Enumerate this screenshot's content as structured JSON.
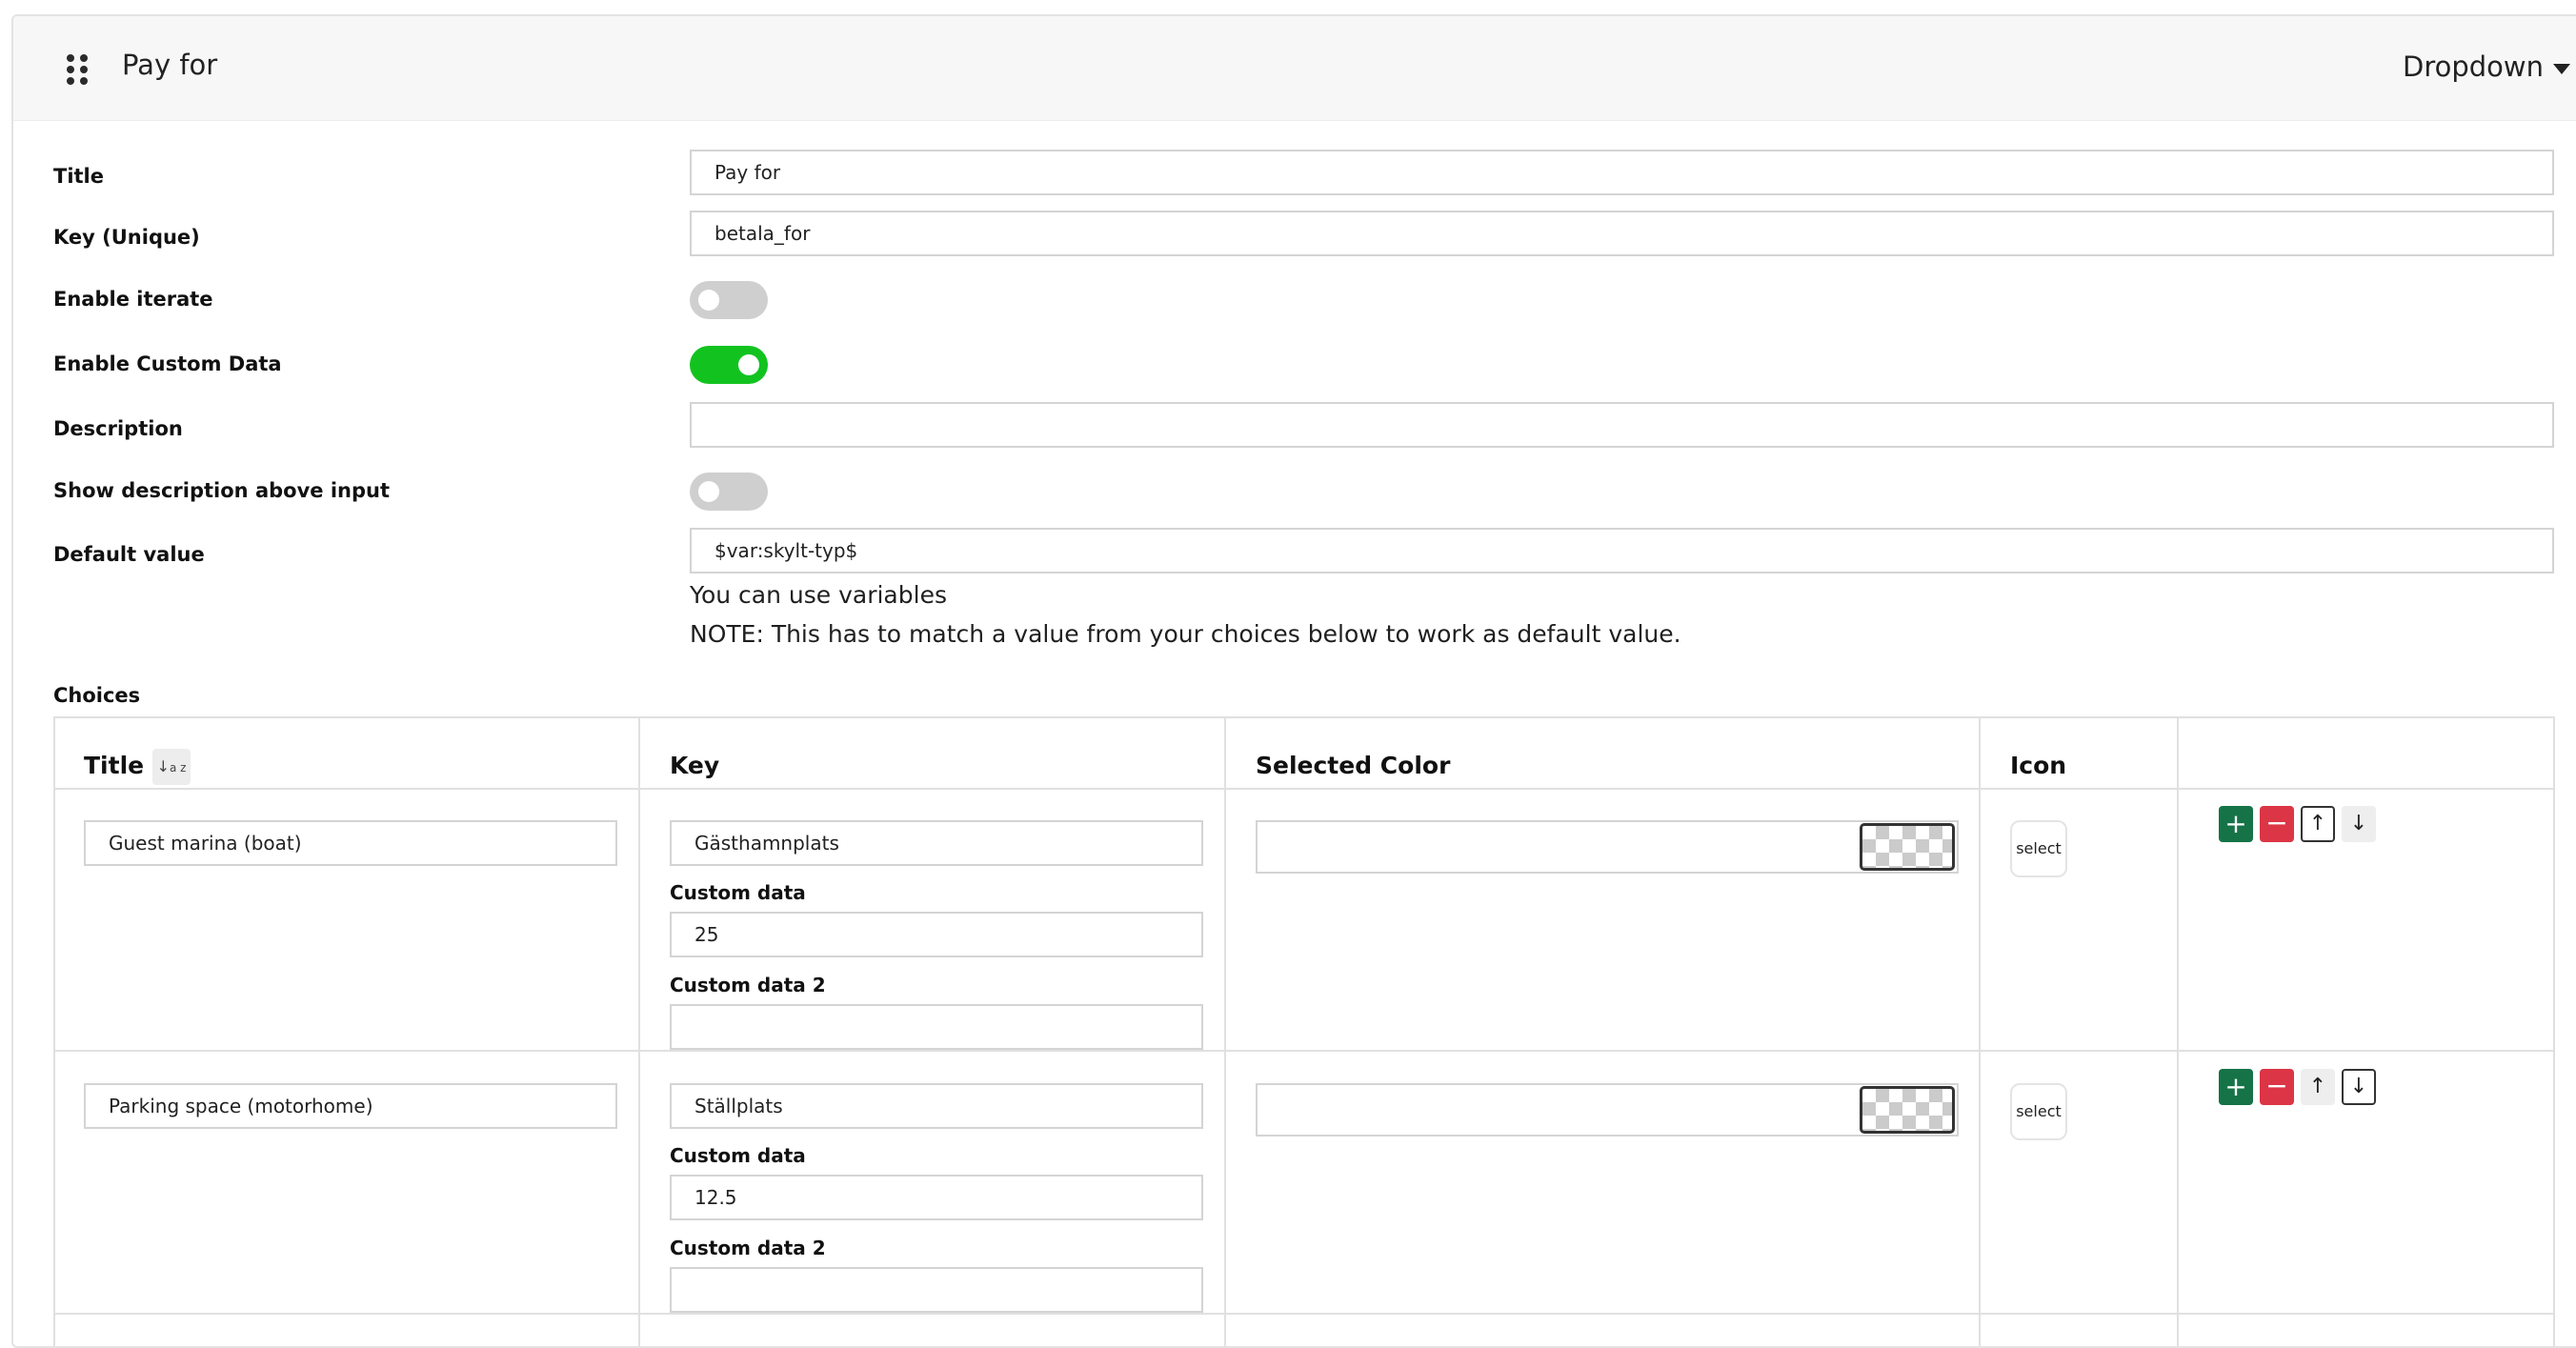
{
  "header": {
    "title": "Pay for",
    "type_dropdown": "Dropdown"
  },
  "fields": {
    "title_label": "Title",
    "title_value": "Pay for",
    "key_label": "Key (Unique)",
    "key_value": "betala_for",
    "enable_iterate_label": "Enable iterate",
    "enable_iterate_on": false,
    "enable_custom_data_label": "Enable Custom Data",
    "enable_custom_data_on": true,
    "description_label": "Description",
    "description_value": "",
    "show_description_label": "Show description above input",
    "show_description_on": false,
    "default_value_label": "Default value",
    "default_value": "$var:skylt-typ$",
    "hint_variables": "You can use variables",
    "hint_note": "NOTE: This has to match a value from your choices below to work as default value."
  },
  "choices": {
    "label": "Choices",
    "columns": {
      "title": "Title",
      "sort_icon": "sort-alpha-icon",
      "key": "Key",
      "selected_color": "Selected Color",
      "icon": "Icon"
    },
    "custom_data_label": "Custom data",
    "custom_data_2_label": "Custom data 2",
    "select_label": "select",
    "rows": [
      {
        "title": "Guest marina (boat)",
        "key": "Gästhamnplats",
        "custom_data": "25",
        "custom_data_2": "",
        "color": ""
      },
      {
        "title": "Parking space (motorhome)",
        "key": "Ställplats",
        "custom_data": "12.5",
        "custom_data_2": "",
        "color": ""
      }
    ]
  },
  "colors": {
    "toggle_on": "#12c31f",
    "toggle_off": "#cfcfcf",
    "add_button": "#157347",
    "remove_button": "#dc3545"
  }
}
